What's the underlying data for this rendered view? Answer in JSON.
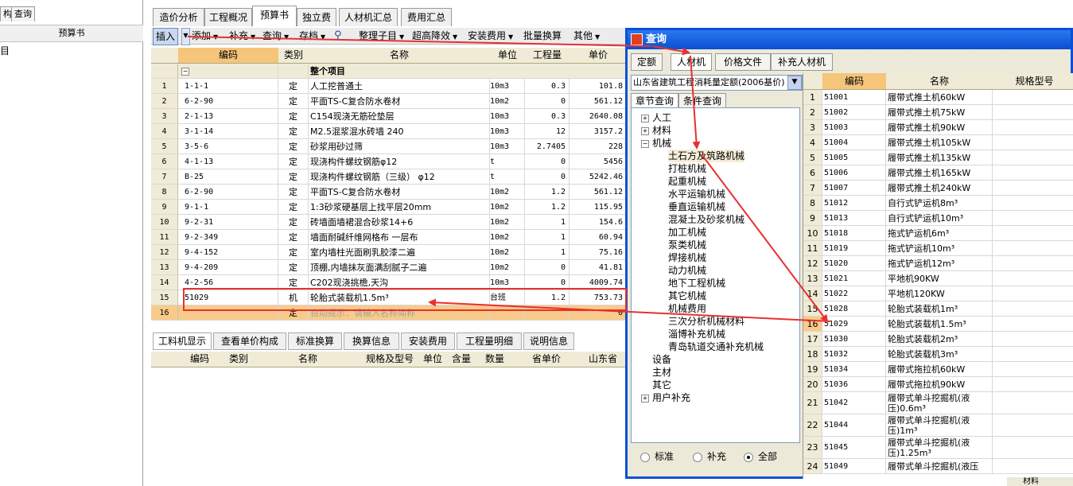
{
  "left": {
    "tabs": [
      "构",
      "查询"
    ],
    "header": "预算书",
    "first_item": "目"
  },
  "top_tabs": [
    "造价分析",
    "工程概况",
    "预算书",
    "独立费",
    "人材机汇总",
    "费用汇总"
  ],
  "toolbar": [
    "插入",
    "添加",
    "补充",
    "查询",
    "存档",
    "整理子目",
    "超高降效",
    "安装费用",
    "批量换算",
    "其他"
  ],
  "grid": {
    "headers": [
      "编码",
      "类别",
      "名称",
      "单位",
      "工程量",
      "单价"
    ],
    "group_label": "整个项目",
    "rows": [
      {
        "n": "1",
        "code": "1-1-1",
        "type": "定",
        "name": "人工挖普通土",
        "unit": "10m3",
        "qty": "0.3",
        "price": "101.8"
      },
      {
        "n": "2",
        "code": "6-2-90",
        "type": "定",
        "name": "平面TS-C复合防水卷材",
        "unit": "10m2",
        "qty": "0",
        "price": "561.12"
      },
      {
        "n": "3",
        "code": "2-1-13",
        "type": "定",
        "name": "C154现浇无筋砼垫层",
        "unit": "10m3",
        "qty": "0.3",
        "price": "2640.08"
      },
      {
        "n": "4",
        "code": "3-1-14",
        "type": "定",
        "name": "M2.5混浆混水砖墙 240",
        "unit": "10m3",
        "qty": "12",
        "price": "3157.2"
      },
      {
        "n": "5",
        "code": "3-5-6",
        "type": "定",
        "name": "砂浆用砂过筛",
        "unit": "10m3",
        "qty": "2.7405",
        "price": "228"
      },
      {
        "n": "6",
        "code": "4-1-13",
        "type": "定",
        "name": "现浇构件螺纹钢筋φ12",
        "unit": "t",
        "qty": "0",
        "price": "5456"
      },
      {
        "n": "7",
        "code": "B-25",
        "type": "定",
        "name": "现浇构件螺纹钢筋（三级） φ12",
        "unit": "t",
        "qty": "0",
        "price": "5242.46"
      },
      {
        "n": "8",
        "code": "6-2-90",
        "type": "定",
        "name": "平面TS-C复合防水卷材",
        "unit": "10m2",
        "qty": "1.2",
        "price": "561.12"
      },
      {
        "n": "9",
        "code": "9-1-1",
        "type": "定",
        "name": "1:3砂浆硬基层上找平层20mm",
        "unit": "10m2",
        "qty": "1.2",
        "price": "115.95"
      },
      {
        "n": "10",
        "code": "9-2-31",
        "type": "定",
        "name": "砖墙面墙裙混合砂浆14+6",
        "unit": "10m2",
        "qty": "1",
        "price": "154.6"
      },
      {
        "n": "11",
        "code": "9-2-349",
        "type": "定",
        "name": "墙面耐碱纤维网格布 一层布",
        "unit": "10m2",
        "qty": "1",
        "price": "60.94"
      },
      {
        "n": "12",
        "code": "9-4-152",
        "type": "定",
        "name": "室内墙柱光面刷乳胶漆二遍",
        "unit": "10m2",
        "qty": "1",
        "price": "75.16"
      },
      {
        "n": "13",
        "code": "9-4-209",
        "type": "定",
        "name": "顶棚,内墙抹灰面满刮腻子二遍",
        "unit": "10m2",
        "qty": "0",
        "price": "41.81"
      },
      {
        "n": "14",
        "code": "4-2-56",
        "type": "定",
        "name": "C202现浇挑檐,天沟",
        "unit": "10m3",
        "qty": "0",
        "price": "4009.74"
      },
      {
        "n": "15",
        "code": "51029",
        "type": "机",
        "name": "轮胎式装载机1.5m³",
        "unit": "台班",
        "qty": "1.2",
        "price": "753.73"
      },
      {
        "n": "16",
        "code": "",
        "type": "定",
        "name": "自动提示：请输入名称简称",
        "unit": "",
        "qty": "",
        "price": "0"
      }
    ]
  },
  "bottom_tabs": [
    "工料机显示",
    "查看单价构成",
    "标准换算",
    "换算信息",
    "安装费用",
    "工程量明细",
    "说明信息"
  ],
  "bottom_headers": [
    "编码",
    "类别",
    "名称",
    "规格及型号",
    "单位",
    "含量",
    "数量",
    "省单价",
    "山东省"
  ],
  "dialog": {
    "title": "查询",
    "tabs": [
      "定额",
      "人材机",
      "价格文件",
      "补充人材机"
    ],
    "combo": "山东省建筑工程消耗量定额(2006基价)",
    "subtabs": [
      "章节查询",
      "条件查询"
    ],
    "tree": {
      "top": [
        "人工",
        "材料",
        "机械"
      ],
      "machinery": [
        "土石方及筑路机械",
        "打桩机械",
        "起重机械",
        "水平运输机械",
        "垂直运输机械",
        "混凝土及砂浆机械",
        "加工机械",
        "泵类机械",
        "焊接机械",
        "动力机械",
        "地下工程机械",
        "其它机械",
        "机械费用",
        "三次分析机械材料",
        "淄博补充机械",
        "青岛轨道交通补充机械"
      ],
      "bottom": [
        "设备",
        "主材",
        "其它",
        "用户补充"
      ]
    },
    "radios": [
      "标准",
      "补充",
      "全部"
    ],
    "grid_headers": [
      "编码",
      "名称",
      "规格型号"
    ],
    "rows": [
      {
        "n": "1",
        "code": "51001",
        "name": "履带式推土机60kW"
      },
      {
        "n": "2",
        "code": "51002",
        "name": "履带式推土机75kW"
      },
      {
        "n": "3",
        "code": "51003",
        "name": "履带式推土机90kW"
      },
      {
        "n": "4",
        "code": "51004",
        "name": "履带式推土机105kW"
      },
      {
        "n": "5",
        "code": "51005",
        "name": "履带式推土机135kW"
      },
      {
        "n": "6",
        "code": "51006",
        "name": "履带式推土机165kW"
      },
      {
        "n": "7",
        "code": "51007",
        "name": "履带式推土机240kW"
      },
      {
        "n": "8",
        "code": "51012",
        "name": "自行式铲运机8m³"
      },
      {
        "n": "9",
        "code": "51013",
        "name": "自行式铲运机10m³"
      },
      {
        "n": "10",
        "code": "51018",
        "name": "拖式铲运机6m³"
      },
      {
        "n": "11",
        "code": "51019",
        "name": "拖式铲运机10m³"
      },
      {
        "n": "12",
        "code": "51020",
        "name": "拖式铲运机12m³"
      },
      {
        "n": "13",
        "code": "51021",
        "name": "平地机90KW"
      },
      {
        "n": "14",
        "code": "51022",
        "name": "平地机120KW"
      },
      {
        "n": "15",
        "code": "51028",
        "name": "轮胎式装载机1m³"
      },
      {
        "n": "16",
        "code": "51029",
        "name": "轮胎式装载机1.5m³"
      },
      {
        "n": "17",
        "code": "51030",
        "name": "轮胎式装载机2m³"
      },
      {
        "n": "18",
        "code": "51032",
        "name": "轮胎式装载机3m³"
      },
      {
        "n": "19",
        "code": "51034",
        "name": "履带式拖拉机60kW"
      },
      {
        "n": "20",
        "code": "51036",
        "name": "履带式拖拉机90kW"
      },
      {
        "n": "21",
        "code": "51042",
        "name": "履带式单斗挖掘机(液压)0.6m³"
      },
      {
        "n": "22",
        "code": "51044",
        "name": "履带式单斗挖掘机(液压)1m³"
      },
      {
        "n": "23",
        "code": "51045",
        "name": "履带式单斗挖掘机(液压)1.25m³"
      },
      {
        "n": "24",
        "code": "51049",
        "name": "履带式单斗挖掘机(液压"
      }
    ]
  },
  "status": {
    "bottom_right": "材料"
  },
  "colors": {
    "highlight_row": "#f8cb8a",
    "annotation_red": "#e83030",
    "dialog_title": "#0a50d8"
  }
}
